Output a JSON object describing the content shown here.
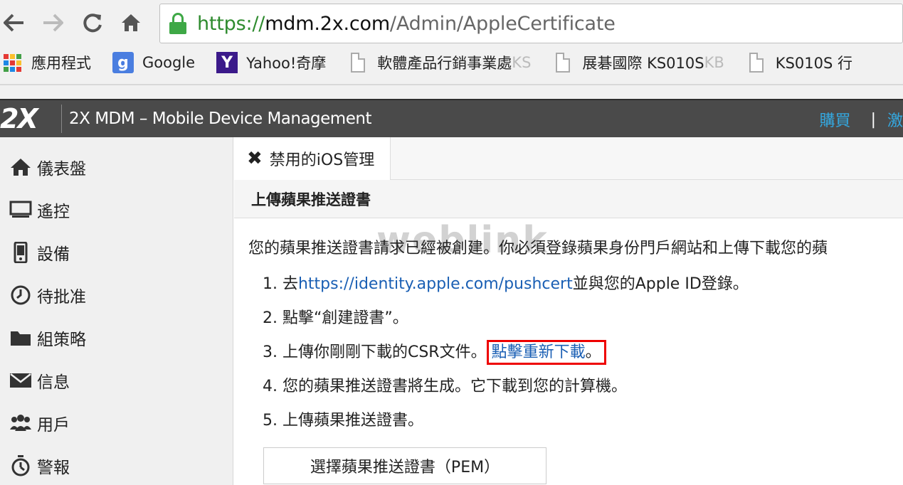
{
  "browser": {
    "url_scheme": "https://",
    "url_host": "mdm.2x.com",
    "url_path": "/Admin/AppleCertificate",
    "bookmarks": [
      {
        "label": "應用程式",
        "icon": "apps-grid-icon"
      },
      {
        "label": "Google",
        "icon": "google-icon"
      },
      {
        "label": "Yahoo!奇摩",
        "icon": "yahoo-icon"
      },
      {
        "label": "軟體產品行銷事業處",
        "fade": "KS",
        "icon": "page-icon"
      },
      {
        "label": "展碁國際 KS010S",
        "fade": " KB",
        "icon": "page-icon"
      },
      {
        "label": "KS010S 行",
        "fade": "",
        "icon": "page-icon"
      }
    ]
  },
  "header": {
    "logo": "2X",
    "title": "2X MDM – Mobile Device Management",
    "link_buy": "購買",
    "link_activate": "激"
  },
  "sidebar": {
    "items": [
      {
        "label": "儀表盤",
        "icon": "home-icon"
      },
      {
        "label": "遙控",
        "icon": "monitor-icon"
      },
      {
        "label": "設備",
        "icon": "phone-icon"
      },
      {
        "label": "待批准",
        "icon": "clock-icon"
      },
      {
        "label": "組策略",
        "icon": "folder-icon"
      },
      {
        "label": "信息",
        "icon": "envelope-icon"
      },
      {
        "label": "用戶",
        "icon": "users-icon"
      },
      {
        "label": "警報",
        "icon": "stopwatch-icon"
      }
    ]
  },
  "main": {
    "tab_label": "禁用的iOS管理",
    "section_title": "上傳蘋果推送證書",
    "intro": "您的蘋果推送證書請求已經被創建。你必須登錄蘋果身份門戶網站和上傳下載您的蘋",
    "watermark": "weblink",
    "steps": {
      "s1_prefix": "1. 去",
      "s1_link": "https://identity.apple.com/pushcert",
      "s1_suffix": "並與您的Apple ID登錄。",
      "s2": "2. 點擊“創建證書”。",
      "s3_prefix": "3. 上傳你剛剛下載的CSR文件。",
      "s3_link": "點擊重新下載",
      "s3_suffix": "。",
      "s4": "4. 您的蘋果推送證書將生成。它下載到您的計算機。",
      "s5": "5. 上傳蘋果推送證書。"
    },
    "upload_button": "選擇蘋果推送證書（PEM）"
  },
  "colors": {
    "header_bg": "#4a4a4a",
    "link_blue": "#1a5fb4",
    "header_link": "#34a8e0",
    "highlight_red": "#e00000",
    "secure_green": "#3ea846"
  }
}
